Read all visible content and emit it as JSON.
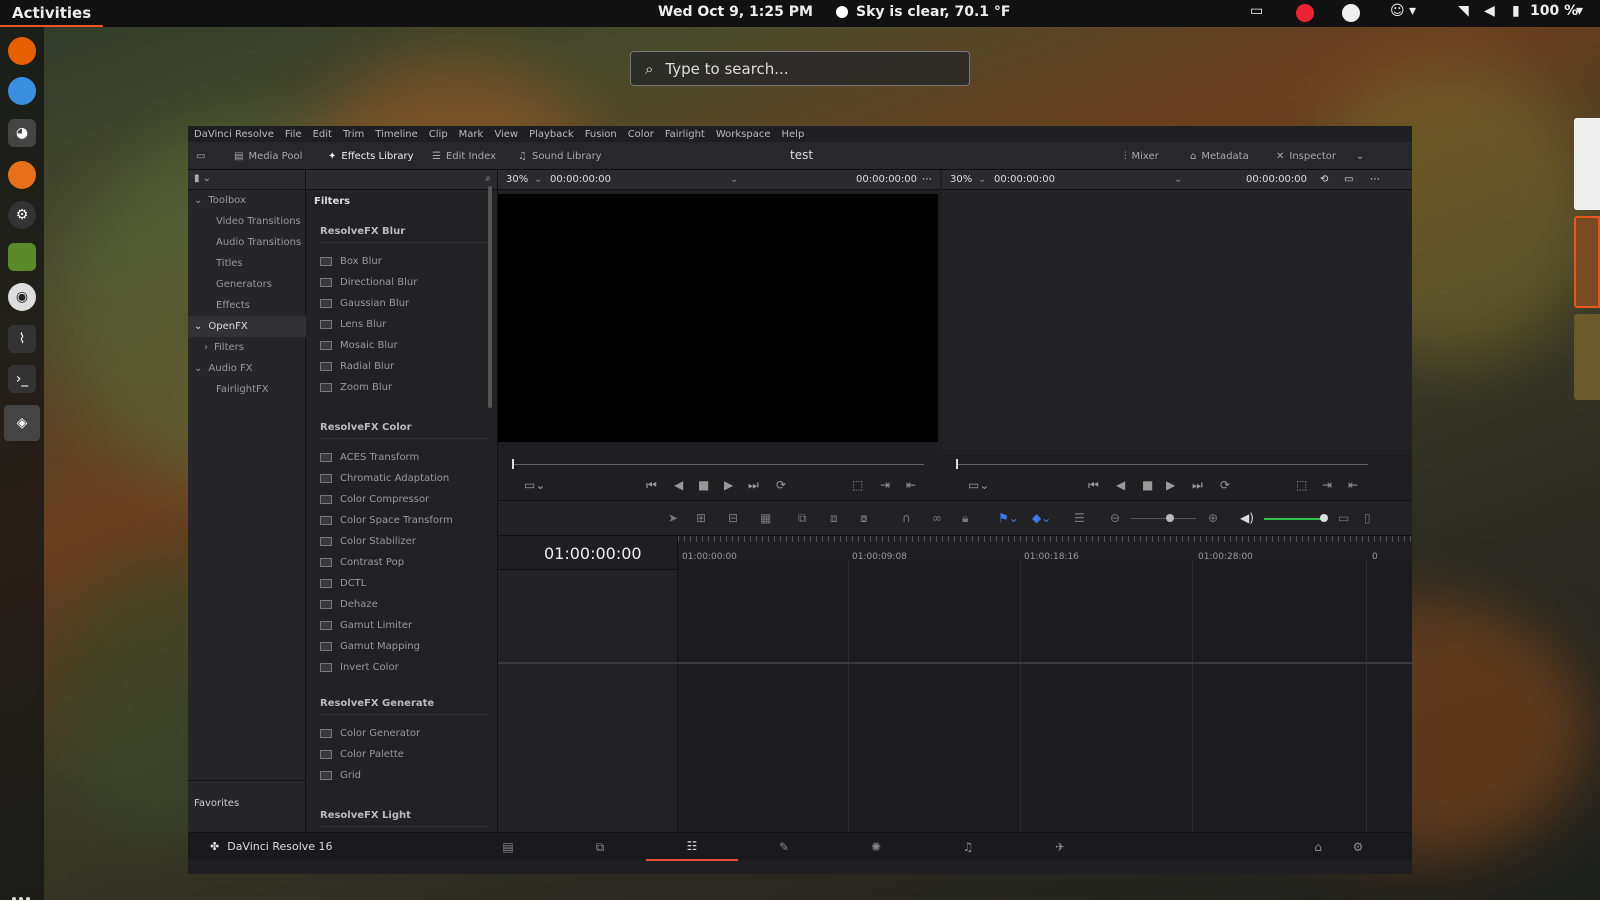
{
  "topbar": {
    "activities": "Activities",
    "clock": "Wed Oct  9,  1:25 PM",
    "weather": "Sky is clear, 70.1 °F",
    "battery": "100 %"
  },
  "search": {
    "placeholder": "Type to search..."
  },
  "menu": [
    "DaVinci Resolve",
    "File",
    "Edit",
    "Trim",
    "Timeline",
    "Clip",
    "Mark",
    "View",
    "Playback",
    "Fusion",
    "Color",
    "Fairlight",
    "Workspace",
    "Help"
  ],
  "toolbar": {
    "media_pool": "Media Pool",
    "effects_library": "Effects Library",
    "edit_index": "Edit Index",
    "sound_library": "Sound Library",
    "project_title": "test",
    "mixer": "Mixer",
    "metadata": "Metadata",
    "inspector": "Inspector"
  },
  "tree": {
    "toolbox": "Toolbox",
    "video_transitions": "Video Transitions",
    "audio_transitions": "Audio Transitions",
    "titles": "Titles",
    "generators": "Generators",
    "effects": "Effects",
    "openfx": "OpenFX",
    "filters": "Filters",
    "audio_fx": "Audio FX",
    "fairlightfx": "FairlightFX",
    "favorites": "Favorites"
  },
  "fx": {
    "title": "Filters",
    "blur_group": "ResolveFX Blur",
    "blur": [
      "Box Blur",
      "Directional Blur",
      "Gaussian Blur",
      "Lens Blur",
      "Mosaic Blur",
      "Radial Blur",
      "Zoom Blur"
    ],
    "color_group": "ResolveFX Color",
    "color": [
      "ACES Transform",
      "Chromatic Adaptation",
      "Color Compressor",
      "Color Space Transform",
      "Color Stabilizer",
      "Contrast Pop",
      "DCTL",
      "Dehaze",
      "Gamut Limiter",
      "Gamut Mapping",
      "Invert Color"
    ],
    "generate_group": "ResolveFX Generate",
    "generate": [
      "Color Generator",
      "Color Palette",
      "Grid"
    ],
    "light_group": "ResolveFX Light"
  },
  "viewers": {
    "left_zoom": "30%",
    "left_tc": "00:00:00:00",
    "left_tc2": "00:00:00:00",
    "right_zoom": "30%",
    "right_tc": "00:00:00:00",
    "right_tc2": "00:00:00:00"
  },
  "timeline": {
    "timecode": "01:00:00:00",
    "ruler": [
      "01:00:00:00",
      "01:00:09:08",
      "01:00:18:16",
      "01:00:28:00",
      "0"
    ]
  },
  "bottombar": {
    "app_name": "DaVinci Resolve 16"
  }
}
